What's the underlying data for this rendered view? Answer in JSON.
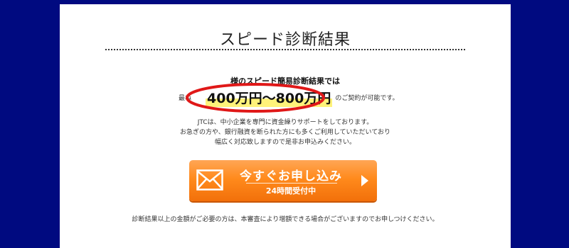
{
  "page": {
    "title": "スピード診断結果",
    "background_color": "#000a80",
    "panel_color": "#ffffff"
  },
  "result": {
    "heading": "様のスピード簡易診断結果では",
    "prefix": "最ね",
    "amount": "400万円〜800万円",
    "suffix": "のご契約が可能です。",
    "highlight_color": "#fff27a",
    "circle_color": "#e01818"
  },
  "description": {
    "lines": [
      "JTCは、中小企業を専門に資金繰りサポートをしております。",
      "お急ぎの方や、銀行融資を断られた方にも多くご利用していただいており",
      "幅広く対応致しますので是非お申込みください。"
    ]
  },
  "cta": {
    "label": "今すぐお申し込み",
    "sublabel": "24時間受付中",
    "icon": "mail-icon",
    "arrow_icon": "chevron-right-icon",
    "color": "#ff8a1c"
  },
  "footnote": "診断結果以上の金額がご必要の方は、本審査により増額できる場合がございますのでお申しつけください。"
}
